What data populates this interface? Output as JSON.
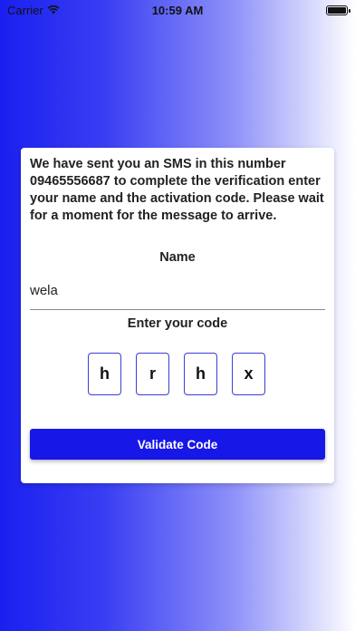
{
  "status_bar": {
    "carrier": "Carrier",
    "time": "10:59 AM"
  },
  "card": {
    "intro": "We have sent you an SMS in this number 09465556687 to complete the verification enter your name and the activation code. Please wait for a moment for the message to arrive.",
    "name_label": "Name",
    "name_value": "wela",
    "code_label": "Enter your code",
    "code_digits": [
      "h",
      "r",
      "h",
      "x"
    ],
    "validate_label": "Validate Code"
  },
  "colors": {
    "accent": "#1717e8"
  }
}
